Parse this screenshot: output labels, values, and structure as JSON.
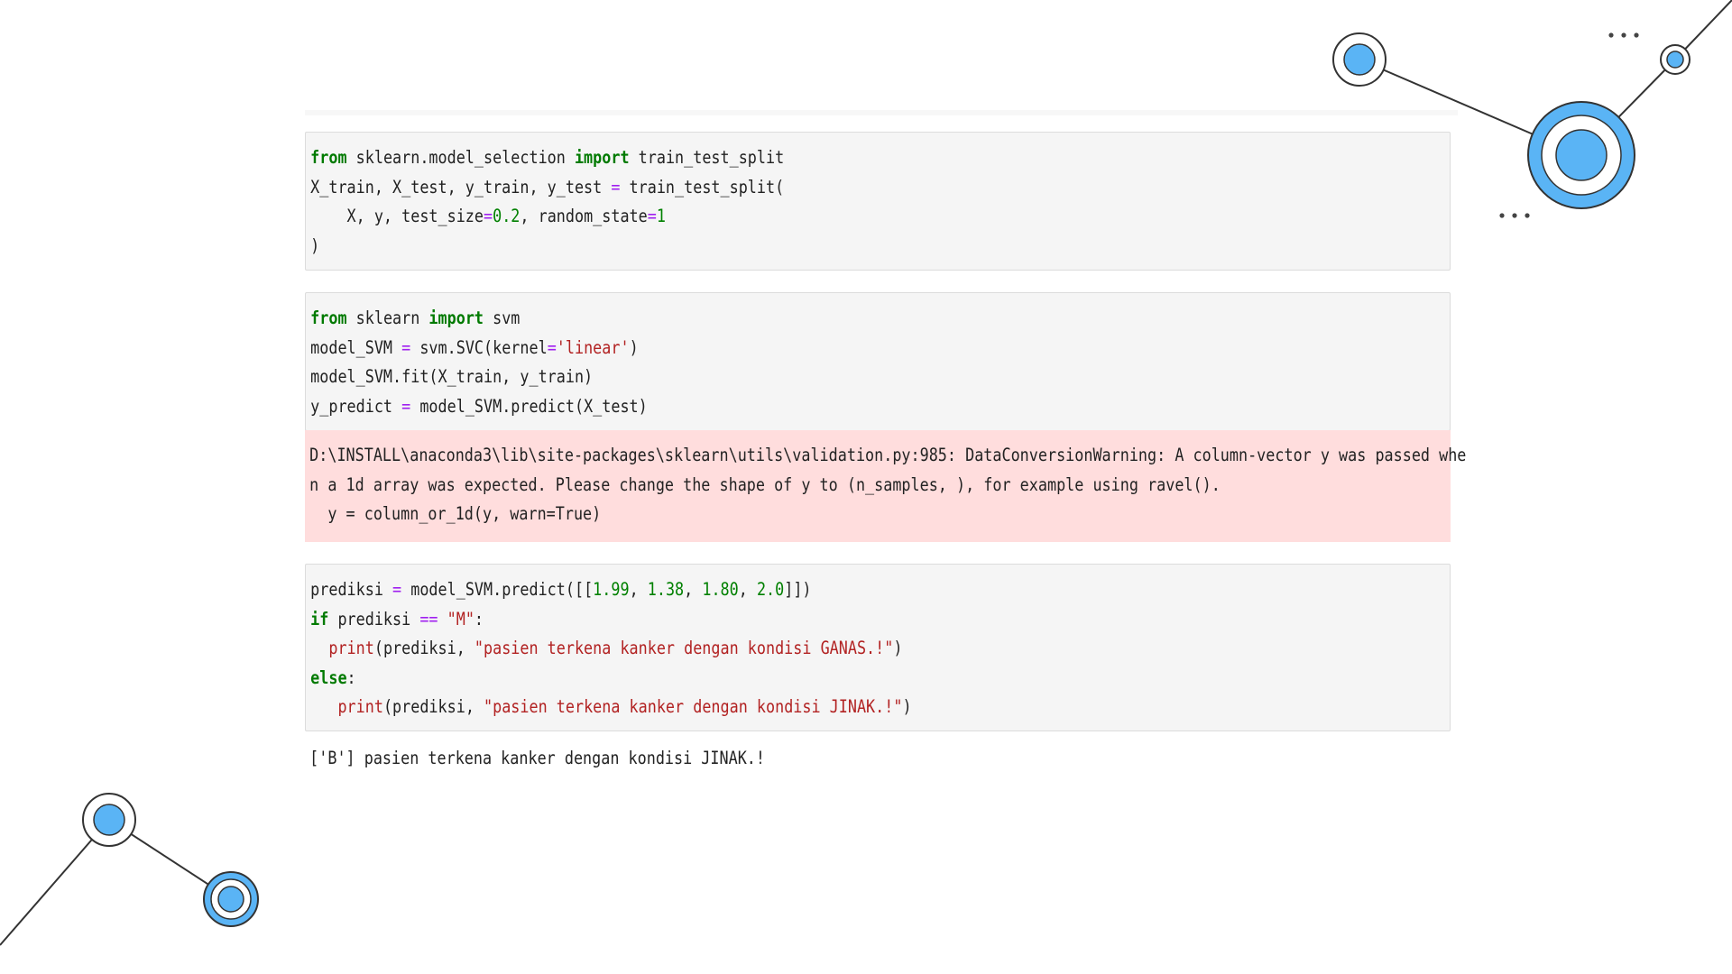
{
  "cells": [
    {
      "lines": [
        [
          [
            "kw",
            "from"
          ],
          [
            "t",
            " sklearn.model_selection "
          ],
          [
            "kw",
            "import"
          ],
          [
            "t",
            " train_test_split"
          ]
        ],
        [
          [
            "t",
            "X_train, X_test, y_train, y_test "
          ],
          [
            "op",
            "="
          ],
          [
            "t",
            " train_test_split("
          ]
        ],
        [
          [
            "t",
            "    X, y, test_size"
          ],
          [
            "op",
            "="
          ],
          [
            "num",
            "0.2"
          ],
          [
            "t",
            ", random_state"
          ],
          [
            "op",
            "="
          ],
          [
            "num",
            "1"
          ]
        ],
        [
          [
            "t",
            ")"
          ]
        ]
      ]
    },
    {
      "lines": [
        [
          [
            "kw",
            "from"
          ],
          [
            "t",
            " sklearn "
          ],
          [
            "kw",
            "import"
          ],
          [
            "t",
            " svm"
          ]
        ],
        [
          [
            "t",
            "model_SVM "
          ],
          [
            "op",
            "="
          ],
          [
            "t",
            " svm.SVC(kernel"
          ],
          [
            "op",
            "="
          ],
          [
            "str",
            "'linear'"
          ],
          [
            "t",
            ")"
          ]
        ],
        [
          [
            "t",
            "model_SVM.fit(X_train, y_train)"
          ]
        ],
        [
          [
            "t",
            "y_predict "
          ],
          [
            "op",
            "="
          ],
          [
            "t",
            " model_SVM.predict(X_test)"
          ]
        ]
      ]
    },
    {
      "lines": [
        [
          [
            "t",
            "prediksi "
          ],
          [
            "op",
            "="
          ],
          [
            "t",
            " model_SVM.predict([["
          ],
          [
            "num",
            "1.99"
          ],
          [
            "t",
            ", "
          ],
          [
            "num",
            "1.38"
          ],
          [
            "t",
            ", "
          ],
          [
            "num",
            "1.80"
          ],
          [
            "t",
            ", "
          ],
          [
            "num",
            "2.0"
          ],
          [
            "t",
            "]])"
          ]
        ],
        [
          [
            "kw",
            "if"
          ],
          [
            "t",
            " prediksi "
          ],
          [
            "op",
            "=="
          ],
          [
            "t",
            " "
          ],
          [
            "str",
            "\"M\""
          ],
          [
            "t",
            ":"
          ]
        ],
        [
          [
            "t",
            "  "
          ],
          [
            "fn",
            "print"
          ],
          [
            "t",
            "(prediksi, "
          ],
          [
            "str",
            "\"pasien terkena kanker dengan kondisi GANAS.!\""
          ],
          [
            "t",
            ")"
          ]
        ],
        [
          [
            "kw",
            "else"
          ],
          [
            "t",
            ":"
          ]
        ],
        [
          [
            "t",
            "   "
          ],
          [
            "fn",
            "print"
          ],
          [
            "t",
            "(prediksi, "
          ],
          [
            "str",
            "\"pasien terkena kanker dengan kondisi JINAK.!\""
          ],
          [
            "t",
            ")"
          ]
        ]
      ]
    }
  ],
  "warning": {
    "lines": [
      "D:\\INSTALL\\anaconda3\\lib\\site-packages\\sklearn\\utils\\validation.py:985: DataConversionWarning: A column-vector y was passed whe",
      "n a 1d array was expected. Please change the shape of y to (n_samples, ), for example using ravel().",
      "  y = column_or_1d(y, warn=True)"
    ]
  },
  "output": {
    "text": "['B'] pasien terkena kanker dengan kondisi JINAK.!"
  },
  "colors": {
    "accent_blue": "#5ab4f5",
    "warning_bg": "#ffdddd",
    "keyword": "#007a00",
    "string": "#b22222",
    "operator": "#a020f0"
  }
}
